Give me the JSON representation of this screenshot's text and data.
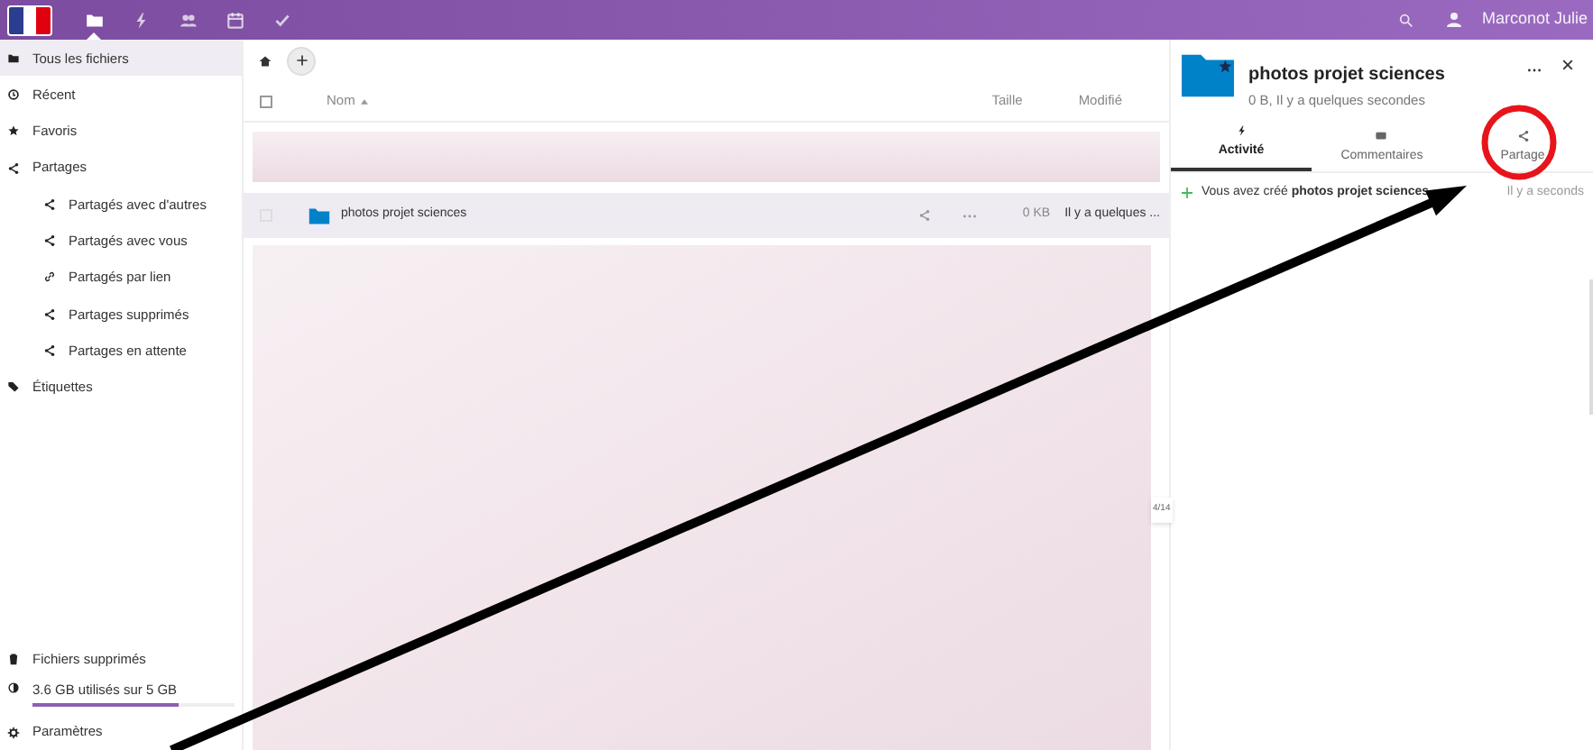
{
  "header": {
    "apps": [
      {
        "kind": "folder",
        "selected": true
      },
      {
        "kind": "bolt",
        "selected": false
      },
      {
        "kind": "contacts",
        "selected": false
      },
      {
        "kind": "calendar",
        "selected": false
      },
      {
        "kind": "check",
        "selected": false
      }
    ],
    "user": "Marconot Julie"
  },
  "sidebar": {
    "items": [
      {
        "label": "Tous les fichiers",
        "kind": "folder",
        "selected": true
      },
      {
        "label": "Récent",
        "kind": "clock",
        "selected": false
      },
      {
        "label": "Favoris",
        "kind": "star",
        "selected": false
      },
      {
        "label": "Partages",
        "kind": "share",
        "selected": false,
        "children": [
          {
            "label": "Partagés avec d'autres",
            "kind": "share",
            "selected": false
          },
          {
            "label": "Partagés avec vous",
            "kind": "share",
            "selected": false
          },
          {
            "label": "Partagés par lien",
            "kind": "link",
            "selected": false
          },
          {
            "label": "Partages supprimés",
            "kind": "share",
            "selected": false
          },
          {
            "label": "Partages en attente",
            "kind": "share",
            "selected": false
          }
        ]
      },
      {
        "label": "Étiquettes",
        "kind": "tag",
        "selected": false
      }
    ],
    "bottom": [
      {
        "label": "Fichiers supprimés",
        "kind": "trash"
      }
    ],
    "quota": {
      "text": "3.6 GB utilisés sur 5 GB",
      "level": 0.72
    },
    "settings": "Paramètres"
  },
  "files": {
    "columns": [
      "Nom",
      "Taille",
      "Modifié"
    ],
    "select_all_checked": false,
    "rows": [
      {
        "name": "photos projet sciences",
        "size": "0 KB",
        "modified": "Il y a quelques ...",
        "selected": true,
        "checked": false
      }
    ],
    "page_indicator": "4/14"
  },
  "details": {
    "title": "photos projet sciences",
    "subtitle": "0 B, Il y a quelques secondes",
    "tabs": [
      {
        "label": "Activité",
        "kind": "bolt",
        "selected": true
      },
      {
        "label": "Commentaires",
        "kind": "comment",
        "selected": false
      },
      {
        "label": "Partage",
        "kind": "share",
        "selected": false
      }
    ],
    "activity": [
      {
        "text": "Vous avez créé **photos projet sciences**",
        "time": "Il y a seconds"
      }
    ]
  }
}
